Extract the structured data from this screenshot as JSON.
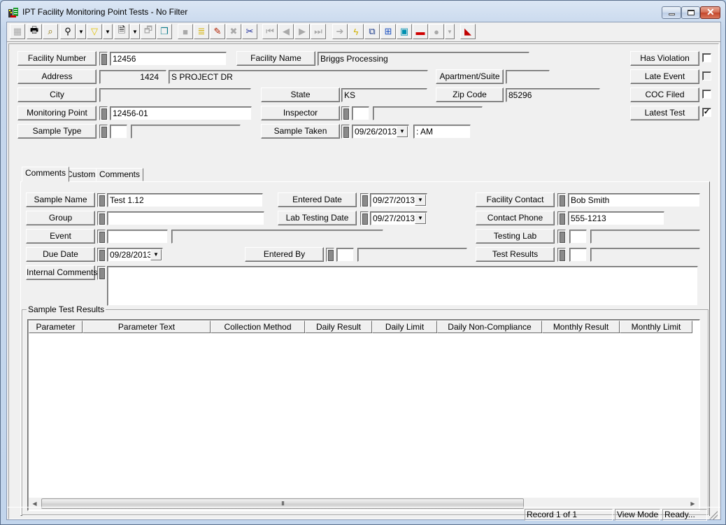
{
  "window": {
    "title": "IPT Facility Monitoring Point Tests - No Filter",
    "controls": {
      "minimize": "minimize",
      "maximize": "maximize",
      "close": "close"
    }
  },
  "toolbar": {
    "buttons": [
      {
        "name": "select-all",
        "icon": "grid-icon",
        "enabled": false
      },
      {
        "name": "print",
        "icon": "printer-icon",
        "enabled": true
      },
      {
        "name": "print-preview",
        "icon": "magnifier-icon",
        "enabled": true
      },
      {
        "name": "find",
        "icon": "binoculars-icon",
        "enabled": true,
        "dropdown": true
      },
      {
        "name": "filter",
        "icon": "funnel-icon",
        "enabled": true,
        "dropdown": true
      },
      {
        "name": "report",
        "icon": "report-icon",
        "enabled": true,
        "dropdown": true
      },
      {
        "name": "export",
        "icon": "export-icon",
        "enabled": false
      },
      {
        "name": "copy-record",
        "icon": "copy-icon",
        "enabled": true
      },
      {
        "name": "save",
        "icon": "save-icon",
        "enabled": false
      },
      {
        "name": "add-record",
        "icon": "stack-add-icon",
        "enabled": true
      },
      {
        "name": "edit",
        "icon": "pencil-icon",
        "enabled": true
      },
      {
        "name": "delete",
        "icon": "x-icon",
        "enabled": false
      },
      {
        "name": "cut",
        "icon": "scissors-icon",
        "enabled": true
      },
      {
        "name": "first-record",
        "icon": "first-icon",
        "enabled": false
      },
      {
        "name": "previous-record",
        "icon": "previous-icon",
        "enabled": false
      },
      {
        "name": "next-record",
        "icon": "next-icon",
        "enabled": false
      },
      {
        "name": "last-record",
        "icon": "last-icon",
        "enabled": false
      },
      {
        "name": "go-to",
        "icon": "arrow-right-icon",
        "enabled": false
      },
      {
        "name": "quick-action",
        "icon": "lightning-icon",
        "enabled": true
      },
      {
        "name": "lookup",
        "icon": "forms-icon",
        "enabled": true
      },
      {
        "name": "hierarchy",
        "icon": "hierarchy-icon",
        "enabled": true
      },
      {
        "name": "map",
        "icon": "map-icon",
        "enabled": true
      },
      {
        "name": "toolbox",
        "icon": "toolbox-icon",
        "enabled": true
      },
      {
        "name": "globe",
        "icon": "globe-icon",
        "enabled": false,
        "dropdown": true
      },
      {
        "name": "exit",
        "icon": "exit-icon",
        "enabled": true
      }
    ]
  },
  "header": {
    "facility_number": {
      "label": "Facility Number",
      "value": "12456"
    },
    "facility_name": {
      "label": "Facility Name",
      "value": "Briggs Processing"
    },
    "address": {
      "label": "Address",
      "number": "1424",
      "street": "S PROJECT DR"
    },
    "apartment": {
      "label": "Apartment/Suite",
      "value": ""
    },
    "city": {
      "label": "City",
      "value": ""
    },
    "state": {
      "label": "State",
      "value": "KS"
    },
    "zip": {
      "label": "Zip Code",
      "value": "85296"
    },
    "monitoring_point": {
      "label": "Monitoring Point",
      "value": "12456-01"
    },
    "inspector": {
      "label": "Inspector",
      "code": "",
      "name": ""
    },
    "sample_type": {
      "label": "Sample Type",
      "code": "",
      "name": ""
    },
    "sample_taken": {
      "label": "Sample Taken",
      "date": "09/26/2013",
      "time": " :  AM"
    },
    "flags": [
      {
        "label": "Has Violation",
        "checked": false
      },
      {
        "label": "Late Event",
        "checked": false
      },
      {
        "label": "COC Filed",
        "checked": false
      },
      {
        "label": "Latest Test",
        "checked": true
      }
    ]
  },
  "tabs": [
    {
      "label": "Comments",
      "active": true
    },
    {
      "label": "Custom",
      "active": false
    },
    {
      "label": "Comments",
      "active": false
    }
  ],
  "detail": {
    "sample_name": {
      "label": "Sample Name",
      "value": "Test 1.12"
    },
    "group": {
      "label": "Group",
      "value": ""
    },
    "event": {
      "label": "Event",
      "code": "",
      "name": ""
    },
    "due_date": {
      "label": "Due Date",
      "value": "09/28/2013"
    },
    "internal_comments": {
      "label": "Internal Comments",
      "value": ""
    },
    "entered_date": {
      "label": "Entered Date",
      "value": "09/27/2013"
    },
    "lab_testing_date": {
      "label": "Lab Testing Date",
      "value": "09/27/2013"
    },
    "entered_by": {
      "label": "Entered By",
      "code": "",
      "name": ""
    },
    "facility_contact": {
      "label": "Facility Contact",
      "value": "Bob Smith"
    },
    "contact_phone": {
      "label": "Contact Phone",
      "value": "555-1213"
    },
    "testing_lab": {
      "label": "Testing Lab",
      "code": "",
      "name": ""
    },
    "test_results": {
      "label": "Test Results",
      "code": "",
      "name": ""
    }
  },
  "results": {
    "title": "Sample Test Results",
    "columns": [
      "Parameter",
      "Parameter Text",
      "Collection Method",
      "Daily Result",
      "Daily Limit",
      "Daily Non-Compliance",
      "Monthly Result",
      "Monthly Limit"
    ],
    "rows": [],
    "scroll_thumb_glyph": "III"
  },
  "status": {
    "record": "Record 1 of 1",
    "mode": "View Mode",
    "state": "Ready..."
  }
}
